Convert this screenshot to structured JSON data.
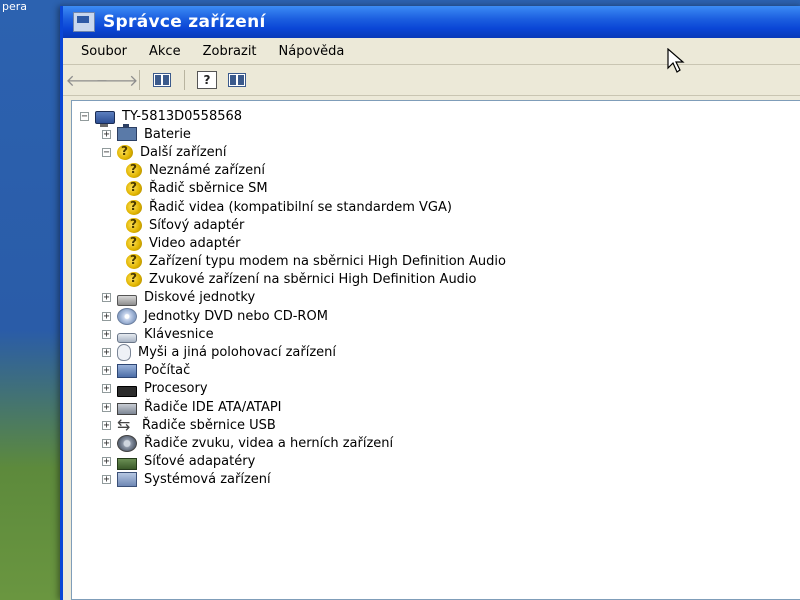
{
  "desktop": {
    "label": "pera"
  },
  "window": {
    "title": "Správce zařízení",
    "menu": [
      "Soubor",
      "Akce",
      "Zobrazit",
      "Nápověda"
    ],
    "toolbar": {
      "back_icon": "back-arrow-icon",
      "forward_icon": "forward-arrow-icon",
      "properties_icon": "properties-icon",
      "help_icon": "help-icon",
      "view_icon": "view-icon"
    }
  },
  "tree": {
    "root": {
      "label": "TY-5813D0558568",
      "expanded": true,
      "icon": "computer-icon"
    },
    "items": [
      {
        "label": "Baterie",
        "expanded": false,
        "icon": "battery-icon"
      },
      {
        "label": "Další zařízení",
        "expanded": true,
        "icon": "warning-device-icon",
        "children": [
          {
            "label": "Neznámé zařízení",
            "icon": "warning-device-icon"
          },
          {
            "label": "Řadič sběrnice SM",
            "icon": "warning-device-icon"
          },
          {
            "label": "Řadič videa (kompatibilní se standardem VGA)",
            "icon": "warning-device-icon"
          },
          {
            "label": "Síťový adaptér",
            "icon": "warning-device-icon"
          },
          {
            "label": "Video adaptér",
            "icon": "warning-device-icon"
          },
          {
            "label": "Zařízení typu modem na sběrnici High Definition Audio",
            "icon": "warning-device-icon"
          },
          {
            "label": "Zvukové zařízení na sběrnici High Definition Audio",
            "icon": "warning-device-icon"
          }
        ]
      },
      {
        "label": "Diskové jednotky",
        "expanded": false,
        "icon": "disk-icon"
      },
      {
        "label": "Jednotky DVD nebo CD-ROM",
        "expanded": false,
        "icon": "dvd-icon"
      },
      {
        "label": "Klávesnice",
        "expanded": false,
        "icon": "keyboard-icon"
      },
      {
        "label": "Myši a jiná polohovací zařízení",
        "expanded": false,
        "icon": "mouse-icon"
      },
      {
        "label": "Počítač",
        "expanded": false,
        "icon": "pc-icon"
      },
      {
        "label": "Procesory",
        "expanded": false,
        "icon": "cpu-icon"
      },
      {
        "label": "Řadiče IDE ATA/ATAPI",
        "expanded": false,
        "icon": "ide-icon"
      },
      {
        "label": "Řadiče sběrnice USB",
        "expanded": false,
        "icon": "usb-icon"
      },
      {
        "label": "Řadiče zvuku, videa a herních zařízení",
        "expanded": false,
        "icon": "sound-icon"
      },
      {
        "label": "Síťové adapatéry",
        "expanded": false,
        "icon": "network-icon"
      },
      {
        "label": "Systémová zařízení",
        "expanded": false,
        "icon": "system-icon"
      }
    ]
  },
  "colors": {
    "titlebar": "#0a46d6",
    "chrome": "#ece9d8",
    "warning": "#e0b400"
  }
}
